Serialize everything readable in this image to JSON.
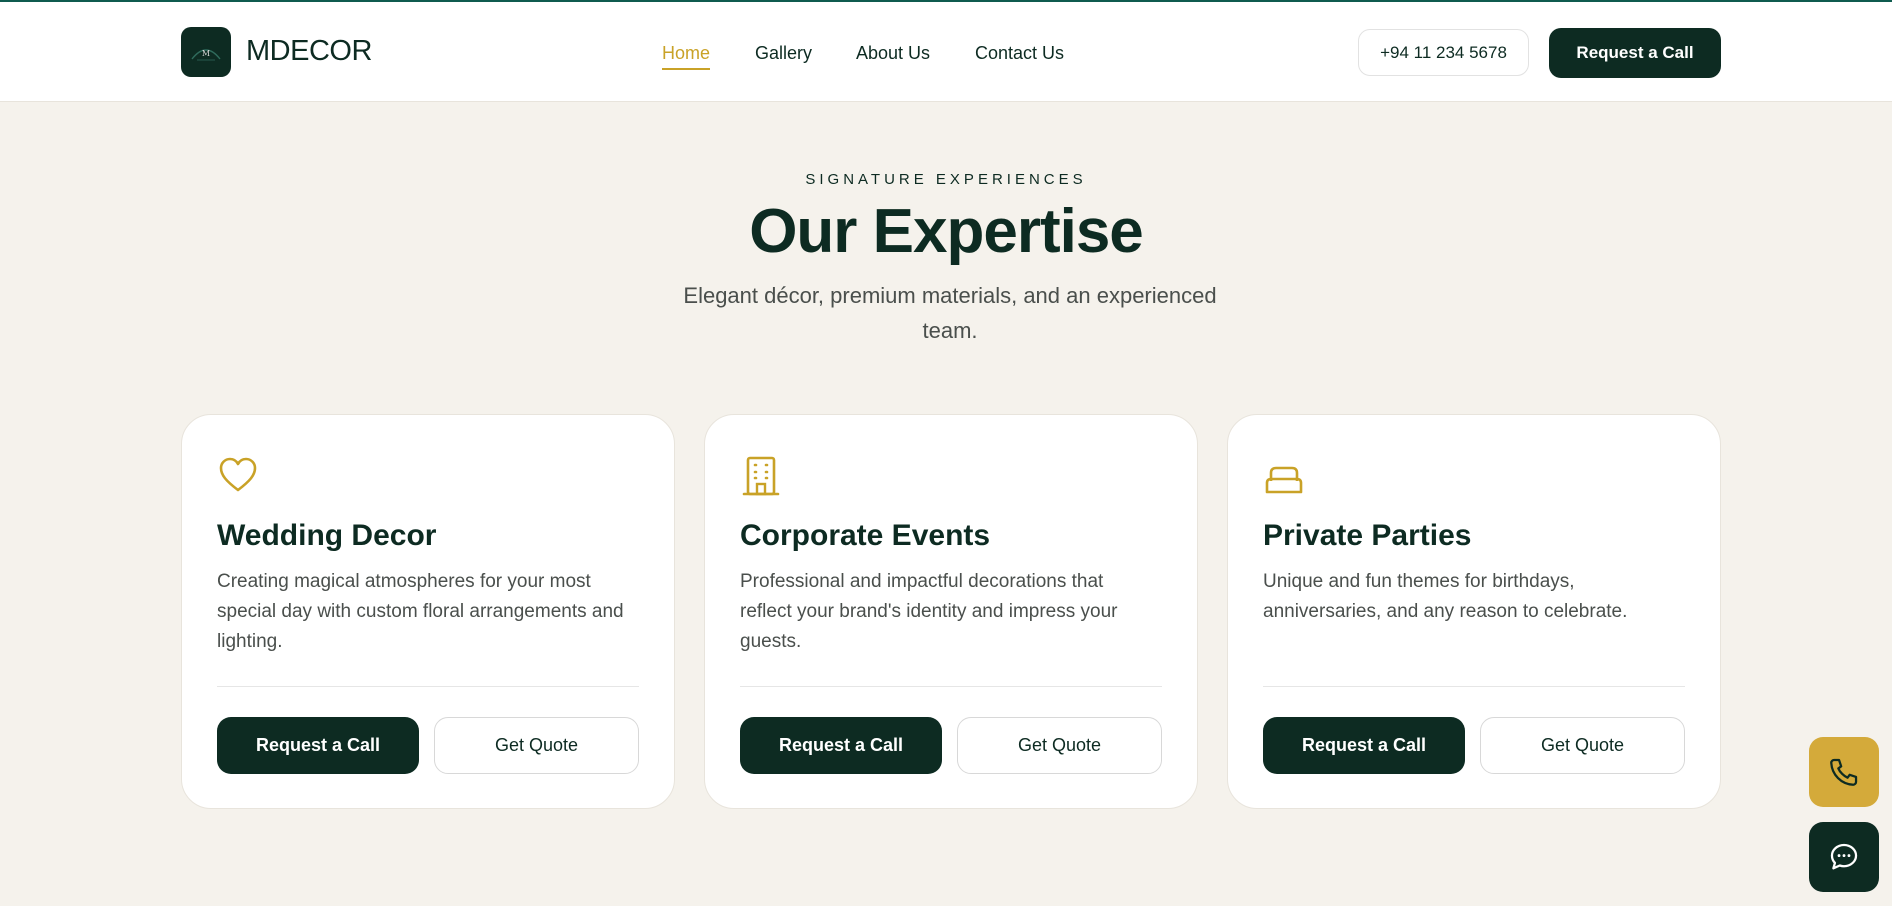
{
  "header": {
    "brand": "MDECOR",
    "logo_icon": "mdecor-logo-icon",
    "nav": [
      "Home",
      "Gallery",
      "About Us",
      "Contact Us"
    ],
    "active_nav": "Home",
    "phone": "+94 11 234 5678",
    "cta": "Request a Call"
  },
  "section": {
    "eyebrow": "SIGNATURE EXPERIENCES",
    "title": "Our Expertise",
    "subtitle": "Elegant décor, premium materials, and an experienced team."
  },
  "cards": [
    {
      "icon": "heart-icon",
      "title": "Wedding Decor",
      "description": "Creating magical atmospheres for your most special day with custom floral arrangements and lighting.",
      "primary": "Request a Call",
      "secondary": "Get Quote"
    },
    {
      "icon": "building-icon",
      "title": "Corporate Events",
      "description": "Professional and impactful decorations that reflect your brand's identity and impress your guests.",
      "primary": "Request a Call",
      "secondary": "Get Quote"
    },
    {
      "icon": "sofa-icon",
      "title": "Private Parties",
      "description": "Unique and fun themes for birthdays, anniversaries, and any reason to celebrate.",
      "primary": "Request a Call",
      "secondary": "Get Quote"
    }
  ],
  "floating": {
    "phone_icon": "phone-icon",
    "chat_icon": "chat-icon"
  },
  "colors": {
    "primary": "#0d2b22",
    "accent": "#c9a227",
    "background": "#f5f2ec"
  }
}
